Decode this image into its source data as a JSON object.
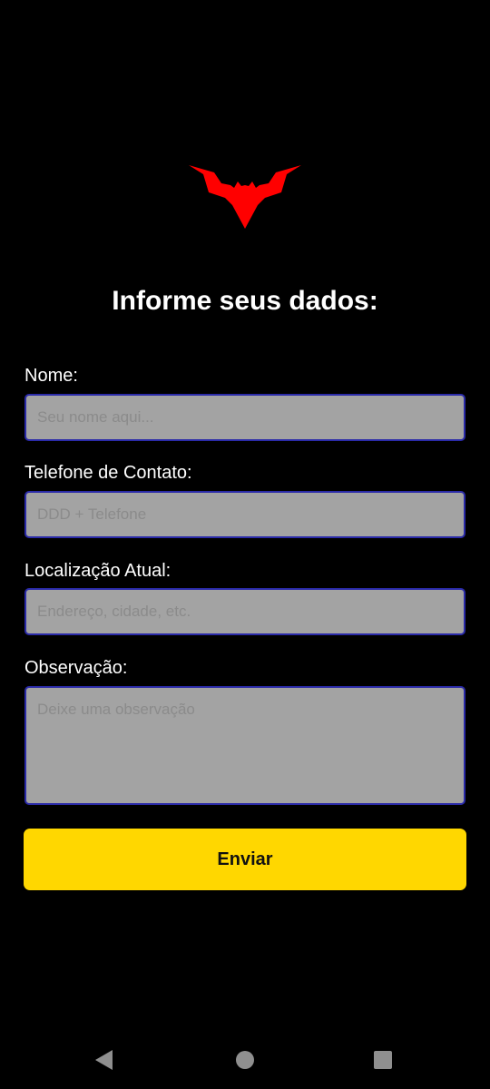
{
  "app": {
    "logo_icon": "bat-logo-icon",
    "accent_color": "#ff0000"
  },
  "form": {
    "title": "Informe seus dados:",
    "fields": [
      {
        "label": "Nome:",
        "placeholder": "Seu nome aqui...",
        "value": ""
      },
      {
        "label": "Telefone de Contato:",
        "placeholder": "DDD + Telefone",
        "value": ""
      },
      {
        "label": "Localização Atual:",
        "placeholder": "Endereço, cidade, etc.",
        "value": ""
      },
      {
        "label": "Observação:",
        "placeholder": "Deixe uma observação",
        "value": ""
      }
    ],
    "submit_label": "Enviar",
    "submit_color": "#ffd700"
  },
  "navbar": {
    "icons": [
      "back-triangle-icon",
      "home-circle-icon",
      "recent-apps-square-icon"
    ]
  }
}
